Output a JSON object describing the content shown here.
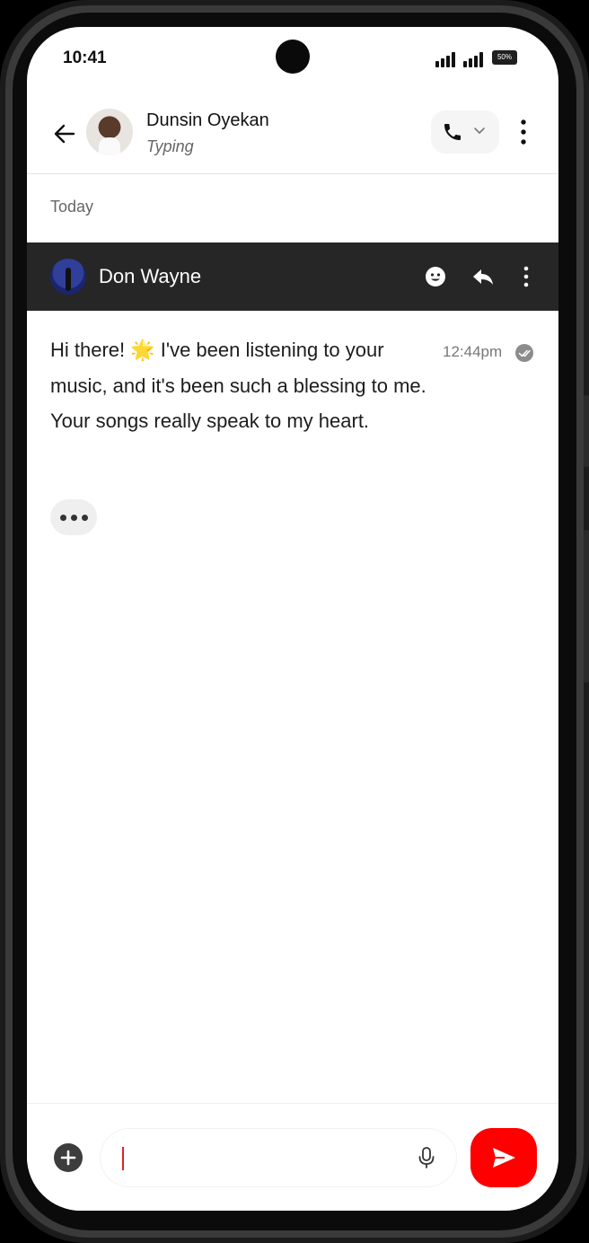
{
  "status_bar": {
    "time": "10:41",
    "battery": "50%"
  },
  "header": {
    "contact_name": "Dunsin Oyekan",
    "contact_status": "Typing"
  },
  "date_separator": "Today",
  "selection_bar": {
    "sender_name": "Don Wayne"
  },
  "message": {
    "text": "Hi there! 🌟 I've been listening to your music, and it's been such a blessing to me. Your songs really speak to my heart.",
    "time": "12:44pm"
  },
  "composer": {
    "input_value": ""
  },
  "colors": {
    "accent": "#FF0000",
    "action_bar": "#262626",
    "caret": "#D8262B"
  },
  "icons": [
    "arrow-left-icon",
    "phone-icon",
    "chevron-down-icon",
    "more-vertical-icon",
    "emoji-icon",
    "reply-icon",
    "double-check-icon",
    "plus-icon",
    "microphone-icon",
    "send-icon"
  ]
}
